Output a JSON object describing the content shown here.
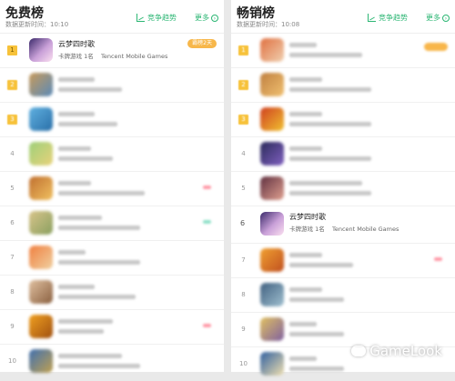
{
  "colors": {
    "accent": "#2bb673",
    "badge": "#f7b74a",
    "rank_top": "#f7c23a",
    "up": "#ff7a8a",
    "down": "#7fdcc0"
  },
  "free": {
    "title": "免费榜",
    "updated_label": "数据更新时间：10:10",
    "trend_label": "竞争趋势",
    "more_label": "更多",
    "featured": {
      "rank": "1",
      "name": "云梦四时歌",
      "subtitle": "卡牌游戏 1名",
      "developer": "Tencent Mobile Games",
      "badge": "霸榜2天"
    },
    "blurred_ranks": [
      "2",
      "3",
      "4",
      "5",
      "6",
      "7",
      "8",
      "9",
      "10"
    ]
  },
  "grossing": {
    "title": "畅销榜",
    "updated_label": "数据更新时间：10:08",
    "trend_label": "竞争趋势",
    "more_label": "更多",
    "blurred_ranks": [
      "1",
      "2",
      "3",
      "4",
      "5"
    ],
    "featured": {
      "rank": "6",
      "name": "云梦四时歌",
      "subtitle": "卡牌游戏 1名",
      "developer": "Tencent Mobile Games"
    },
    "blurred_ranks_after": [
      "7",
      "8",
      "9",
      "10"
    ]
  },
  "watermark": {
    "text": "GameLook",
    "icon": "wechat-icon"
  }
}
